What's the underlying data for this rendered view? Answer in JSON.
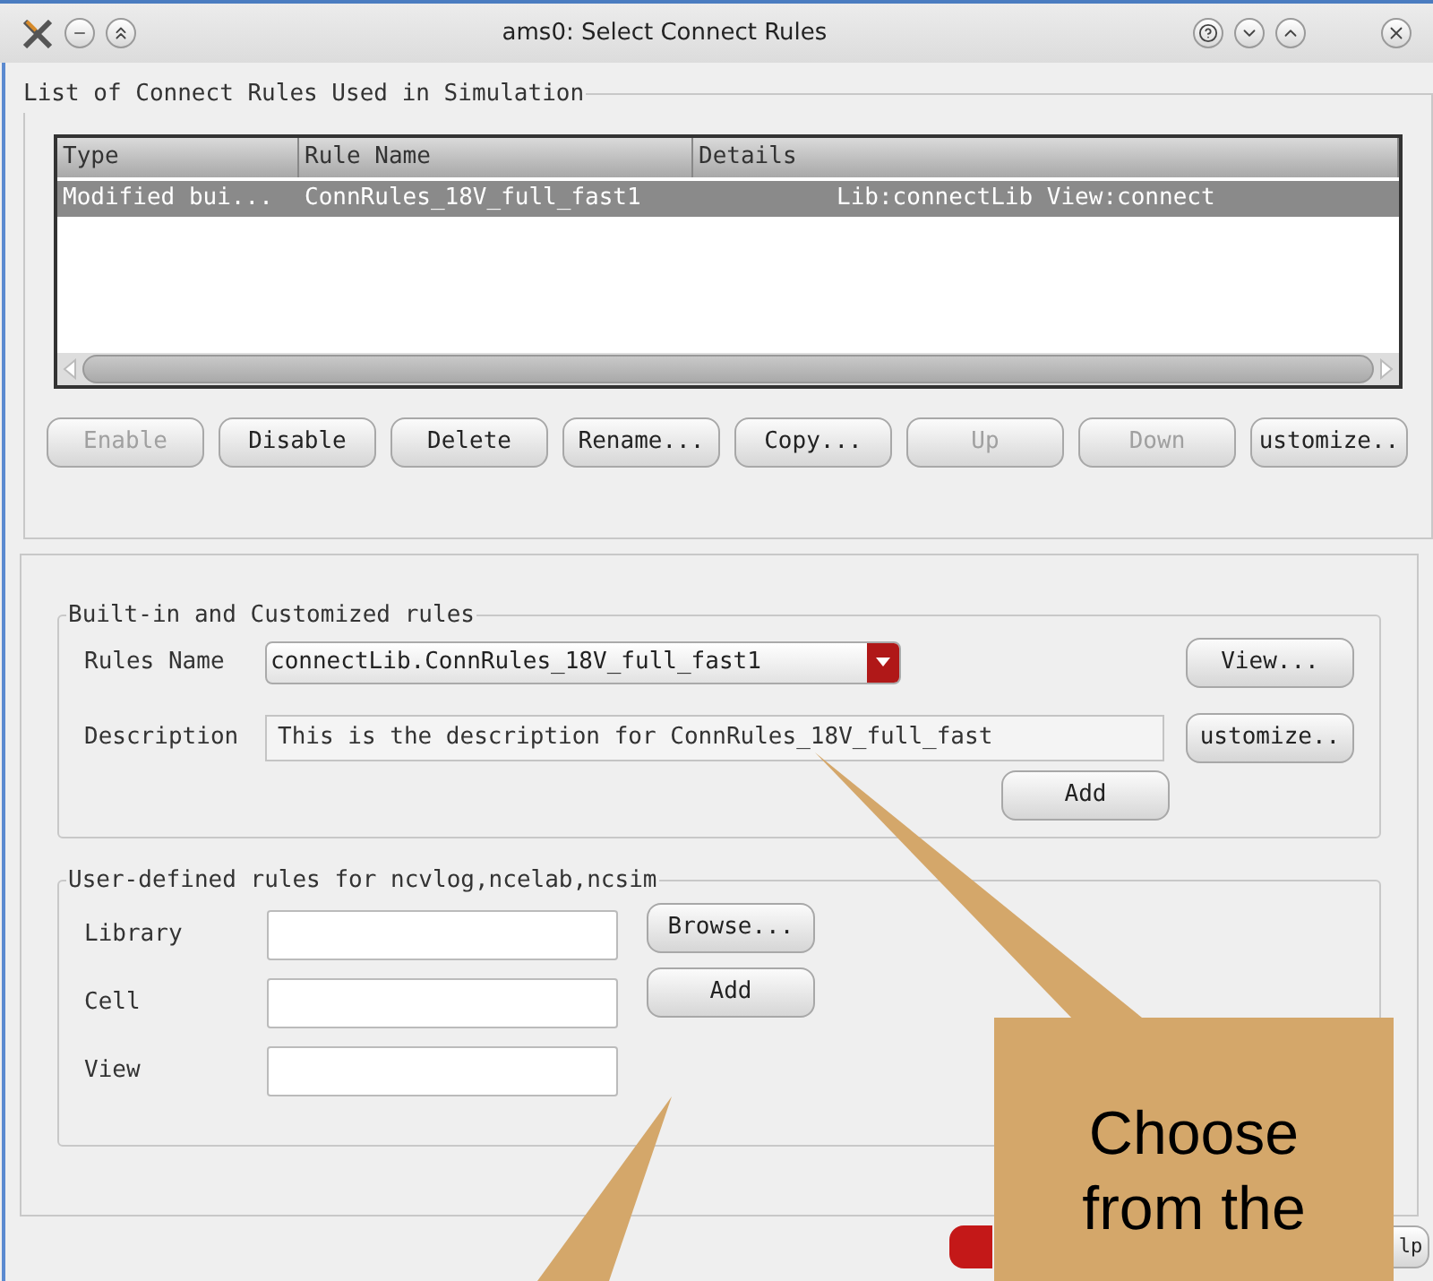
{
  "window": {
    "title": "ams0: Select Connect Rules"
  },
  "rules_group": {
    "title": "List of Connect Rules Used in Simulation",
    "table": {
      "columns": [
        "Type",
        "Rule Name",
        "Details"
      ],
      "rows": [
        {
          "cells": [
            "Modified bui...",
            "ConnRules_18V_full_fast1",
            "Lib:connectLib View:connect"
          ],
          "selected": true
        }
      ]
    },
    "buttons": [
      {
        "label": "Enable",
        "disabled": true
      },
      {
        "label": "Disable",
        "disabled": false
      },
      {
        "label": "Delete",
        "disabled": false
      },
      {
        "label": "Rename...",
        "disabled": false
      },
      {
        "label": "Copy...",
        "disabled": false
      },
      {
        "label": "Up",
        "disabled": true
      },
      {
        "label": "Down",
        "disabled": true
      },
      {
        "label": "ustomize..",
        "disabled": false
      }
    ]
  },
  "builtin_group": {
    "title": "Built-in and Customized rules",
    "rules_name": {
      "label": "Rules Name",
      "value": "connectLib.ConnRules_18V_full_fast1"
    },
    "view_button": "View...",
    "description": {
      "label": "Description",
      "value": "This is the description for ConnRules_18V_full_fast"
    },
    "customize_button": "ustomize..",
    "add_button": "Add"
  },
  "user_group": {
    "title": "User-defined rules for ncvlog,ncelab,ncsim",
    "fields": [
      {
        "label": "Library"
      },
      {
        "label": "Cell"
      },
      {
        "label": "View"
      }
    ],
    "browse_button": "Browse...",
    "add_button": "Add"
  },
  "footer": {
    "help_button": "lp"
  },
  "callout": {
    "text": "Choose\nfrom the"
  }
}
